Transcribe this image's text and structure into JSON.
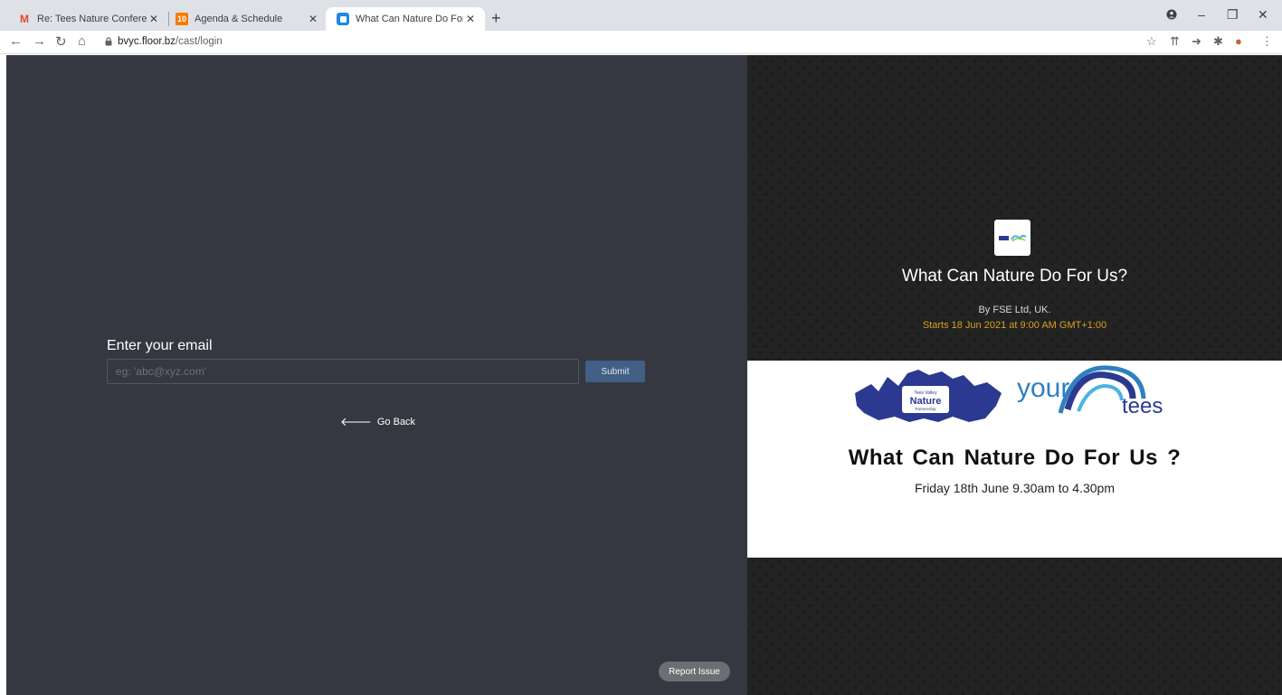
{
  "browser": {
    "tabs": [
      {
        "title": "Re: Tees Nature Conference - ma",
        "favicon": "gmail-icon",
        "active": false
      },
      {
        "title": "Agenda & Schedule",
        "favicon": "calendar-icon",
        "favicon_text": "10",
        "active": false
      },
      {
        "title": "What Can Nature Do For Us? Log",
        "favicon": "floor-icon",
        "active": true
      }
    ],
    "url_host": "bvyc.floor.bz",
    "url_path": "/cast/login"
  },
  "login": {
    "label": "Enter your email",
    "placeholder": "eg: 'abc@xyz.com'",
    "submit_label": "Submit",
    "go_back_label": "Go Back",
    "report_label": "Report Issue"
  },
  "event": {
    "title": "What Can Nature Do For Us?",
    "byline": "By FSE Ltd, UK.",
    "starts": "Starts 18 Jun 2021 at 9:00 AM GMT+1:00"
  },
  "banner": {
    "partner_logo_text": "Tees Valley Nature Partnership",
    "brand_text_1": "your",
    "brand_text_2": "tees",
    "title": "What Can Nature Do  For Us ?",
    "date": "Friday 18th June 9.30am to 4.30pm"
  },
  "colors": {
    "left_bg": "#353840",
    "submit_bg": "#425f86",
    "starts_text": "#d4a21d",
    "right_bg": "#1b1b1b",
    "brand_navy": "#2b3990",
    "brand_blue": "#2f7fc1"
  }
}
